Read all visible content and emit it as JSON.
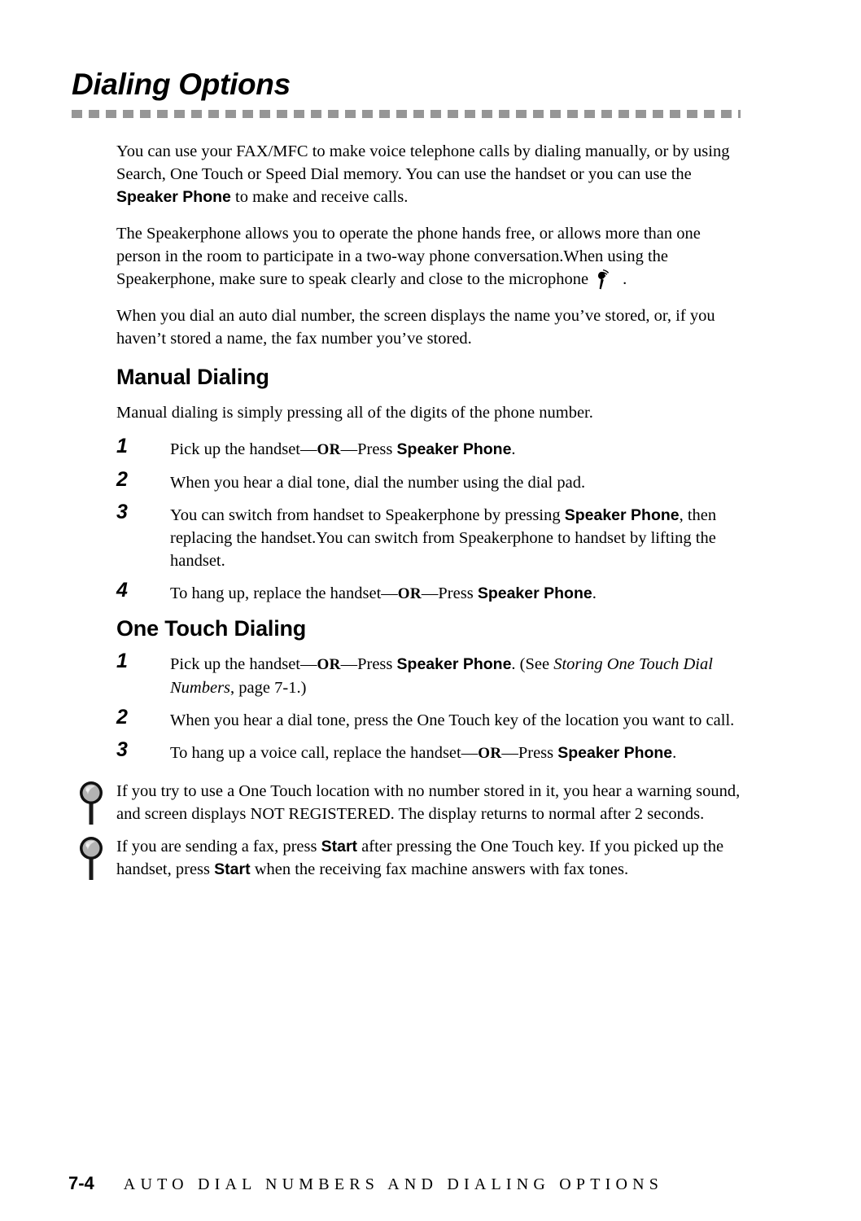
{
  "header": {
    "chapter_title": "Dialing Options",
    "rule_color": "#969696"
  },
  "intro": {
    "para1_a": "You can use your FAX/MFC to make voice telephone calls by dialing manually, or by using Search, One Touch or Speed Dial memory. You can use the handset or you can use the ",
    "para1_key": "Speaker Phone",
    "para1_b": " to make and receive calls.",
    "para2_a": "The Speakerphone allows you to operate the phone hands free, or allows more than one person in the room to participate in a two-way phone conversation.When using the Speakerphone, make sure to speak clearly and close to the microphone",
    "para2_b": ".",
    "para3": "When you dial an auto dial number, the screen displays the name you’ve stored, or, if you haven’t stored a name, the fax number you’ve stored."
  },
  "manual_dialing": {
    "heading": "Manual Dialing",
    "intro": "Manual dialing is simply pressing all of the digits of the phone number.",
    "steps": [
      {
        "num": "1",
        "parts": [
          {
            "t": "Pick up the handset—",
            "s": "plain"
          },
          {
            "t": "OR",
            "s": "or"
          },
          {
            "t": "—Press ",
            "s": "plain"
          },
          {
            "t": "Speaker Phone",
            "s": "key"
          },
          {
            "t": ".",
            "s": "plain"
          }
        ]
      },
      {
        "num": "2",
        "parts": [
          {
            "t": "When you hear a dial tone, dial the number using the dial pad.",
            "s": "plain"
          }
        ]
      },
      {
        "num": "3",
        "parts": [
          {
            "t": "You can switch from handset to Speakerphone by pressing ",
            "s": "plain"
          },
          {
            "t": "Speaker Phone",
            "s": "key"
          },
          {
            "t": ", then replacing the handset.You can switch from Speakerphone to handset by lifting the handset.",
            "s": "plain"
          }
        ]
      },
      {
        "num": "4",
        "parts": [
          {
            "t": "To hang up, replace the handset—",
            "s": "plain"
          },
          {
            "t": "OR",
            "s": "or"
          },
          {
            "t": "—Press ",
            "s": "plain"
          },
          {
            "t": "Speaker Phone",
            "s": "key"
          },
          {
            "t": ".",
            "s": "plain"
          }
        ]
      }
    ]
  },
  "one_touch_dialing": {
    "heading": "One Touch Dialing",
    "steps": [
      {
        "num": "1",
        "parts": [
          {
            "t": "Pick up the handset—",
            "s": "plain"
          },
          {
            "t": "OR",
            "s": "or"
          },
          {
            "t": "—Press ",
            "s": "plain"
          },
          {
            "t": "Speaker Phone",
            "s": "key"
          },
          {
            "t": ". (See ",
            "s": "plain"
          },
          {
            "t": "Storing One Touch Dial Numbers",
            "s": "ital"
          },
          {
            "t": ", page 7-1.)",
            "s": "plain"
          }
        ]
      },
      {
        "num": "2",
        "parts": [
          {
            "t": "When you hear a dial tone, press the One Touch key of the location you want to call.",
            "s": "plain"
          }
        ]
      },
      {
        "num": "3",
        "parts": [
          {
            "t": "To hang up a voice call, replace the handset—",
            "s": "plain"
          },
          {
            "t": "OR",
            "s": "or"
          },
          {
            "t": "—Press ",
            "s": "plain"
          },
          {
            "t": "Speaker Phone",
            "s": "key"
          },
          {
            "t": ".",
            "s": "plain"
          }
        ]
      }
    ],
    "notes": [
      {
        "icon": "magnifier-note-icon",
        "parts": [
          {
            "t": "If you try to use a One Touch location with no number stored in it, you hear a warning sound, and screen displays NOT REGISTERED. The display returns to normal after 2 seconds.",
            "s": "plain"
          }
        ]
      },
      {
        "icon": "magnifier-note-icon",
        "parts": [
          {
            "t": "If you are sending a fax, press ",
            "s": "plain"
          },
          {
            "t": "Start",
            "s": "key"
          },
          {
            "t": " after pressing the One Touch key. If you picked up the handset, press ",
            "s": "plain"
          },
          {
            "t": "Start",
            "s": "key"
          },
          {
            "t": " when the receiving fax machine answers with fax tones.",
            "s": "plain"
          }
        ]
      }
    ]
  },
  "footer": {
    "page_number": "7-4",
    "running_title": "AUTO DIAL NUMBERS AND DIALING OPTIONS"
  }
}
